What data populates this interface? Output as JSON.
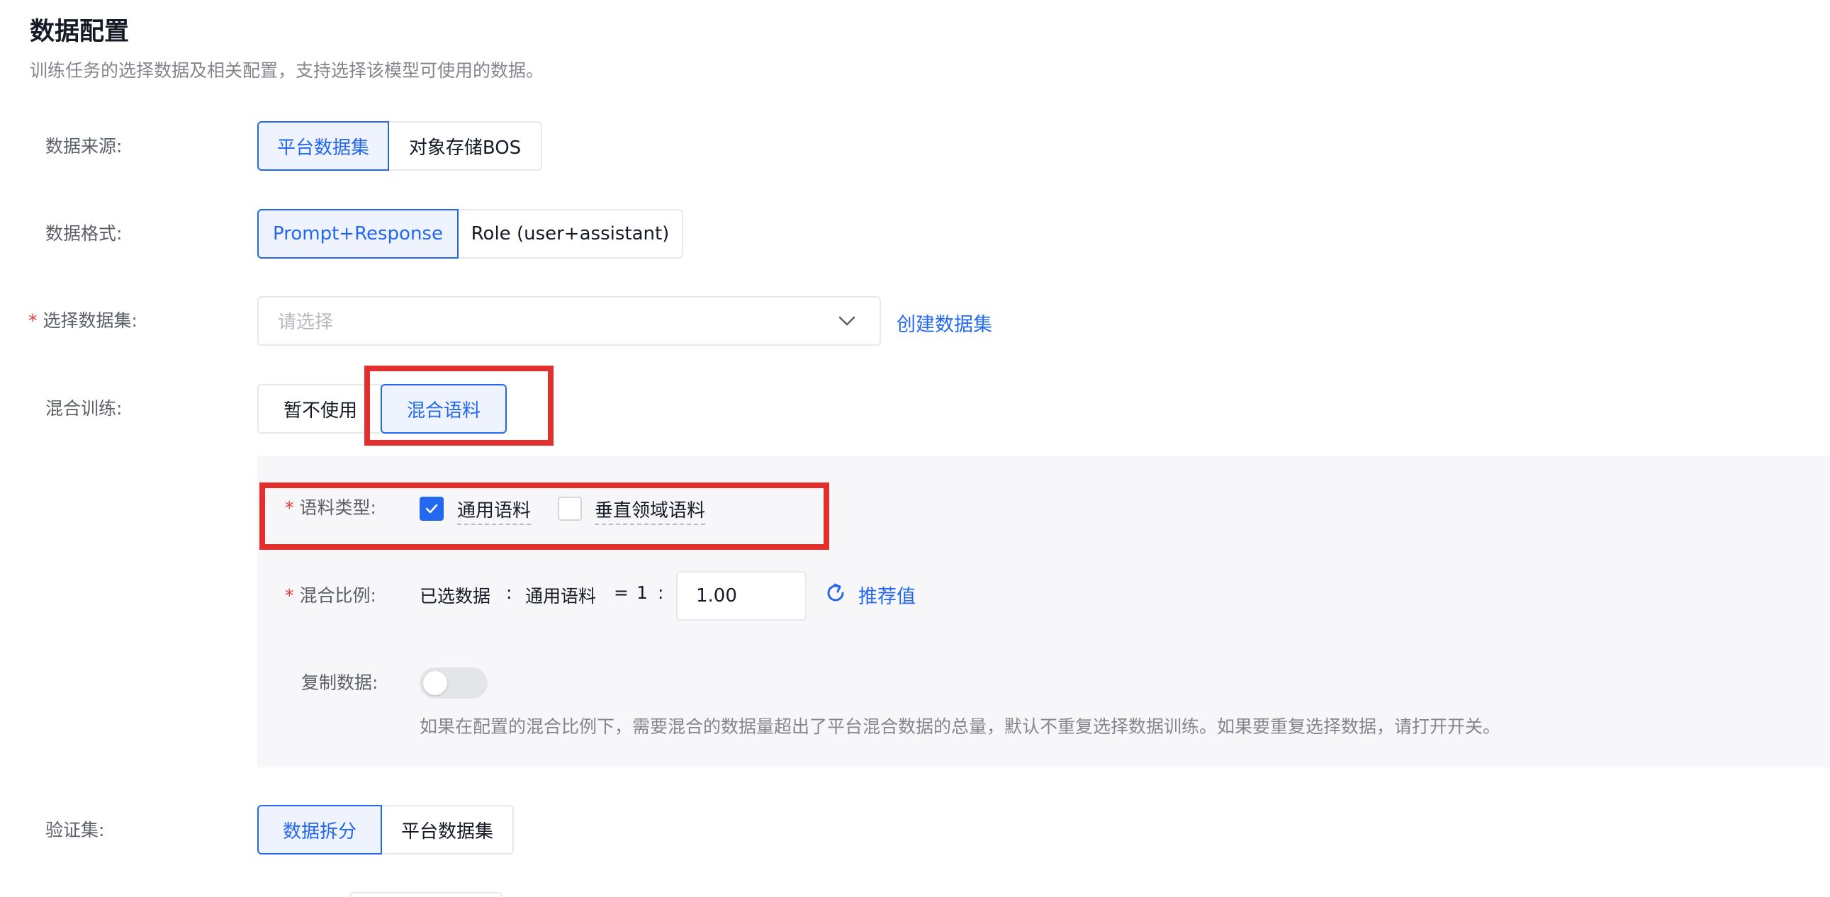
{
  "header": {
    "title": "数据配置",
    "subtitle": "训练任务的选择数据及相关配置，支持选择该模型可使用的数据。"
  },
  "data_source": {
    "label": "数据来源:",
    "options": [
      "平台数据集",
      "对象存储BOS"
    ],
    "selected": "平台数据集"
  },
  "data_format": {
    "label": "数据格式:",
    "options": [
      "Prompt+Response",
      "Role (user+assistant)"
    ],
    "selected": "Prompt+Response"
  },
  "dataset_select": {
    "required_mark": "*",
    "label": "选择数据集:",
    "placeholder": "请选择",
    "create_link": "创建数据集"
  },
  "mixed_training": {
    "label": "混合训练:",
    "options": [
      "暂不使用",
      "混合语料"
    ],
    "selected": "混合语料",
    "corpus_type": {
      "required_mark": "*",
      "label": "语料类型:",
      "options": [
        {
          "label": "通用语料",
          "checked": true
        },
        {
          "label": "垂直领域语料",
          "checked": false
        }
      ]
    },
    "mix_ratio": {
      "required_mark": "*",
      "label": "混合比例:",
      "selected_data": "已选数据",
      "colon1": ":",
      "corpus": "通用语料",
      "equals": "=",
      "one": "1",
      "colon2": ":",
      "value": "1.00",
      "recommend": "推荐值"
    },
    "copy_data": {
      "label": "复制数据:",
      "enabled": false,
      "help": "如果在配置的混合比例下，需要混合的数据量超出了平台混合数据的总量，默认不重复选择数据训练。如果要重复选择数据，请打开开关。"
    }
  },
  "validation_set": {
    "label": "验证集:",
    "options": [
      "数据拆分",
      "平台数据集"
    ],
    "selected": "数据拆分"
  },
  "colors": {
    "accent": "#2468f2",
    "highlight_box": "#e2302f",
    "required": "#e0413a"
  }
}
